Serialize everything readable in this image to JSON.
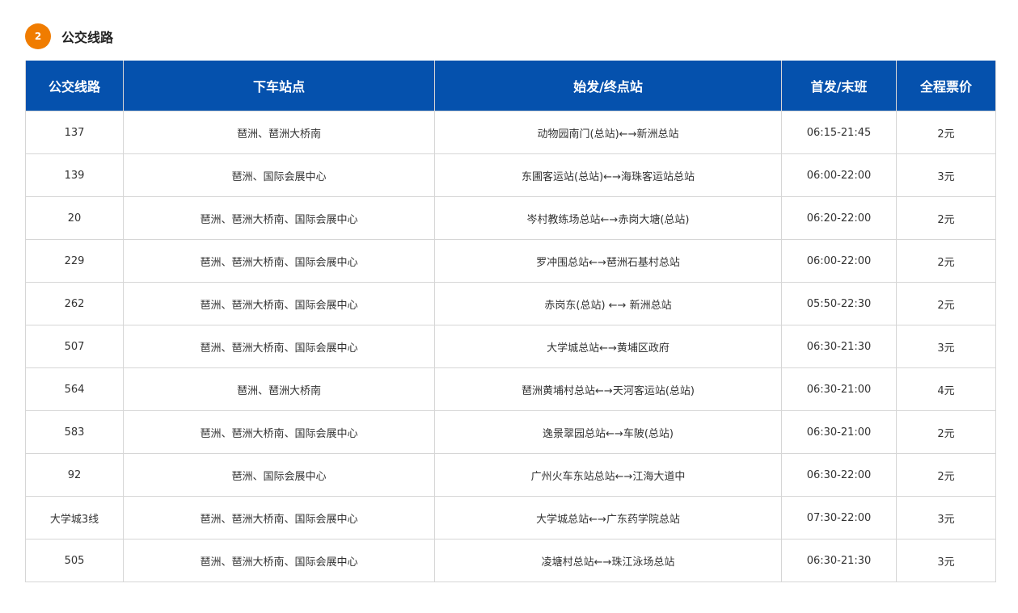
{
  "section": {
    "number": "2",
    "title": "公交线路"
  },
  "table": {
    "headers": [
      "公交线路",
      "下车站点",
      "始发/终点站",
      "首发/末班",
      "全程票价"
    ],
    "rows": [
      [
        "137",
        "琶洲、琶洲大桥南",
        "动物园南门(总站)←→新洲总站",
        "06:15-21:45",
        "2元"
      ],
      [
        "139",
        "琶洲、国际会展中心",
        "东圃客运站(总站)←→海珠客运站总站",
        "06:00-22:00",
        "3元"
      ],
      [
        "20",
        "琶洲、琶洲大桥南、国际会展中心",
        "岑村教练场总站←→赤岗大塘(总站)",
        "06:20-22:00",
        "2元"
      ],
      [
        "229",
        "琶洲、琶洲大桥南、国际会展中心",
        "罗冲围总站←→琶洲石基村总站",
        "06:00-22:00",
        "2元"
      ],
      [
        "262",
        "琶洲、琶洲大桥南、国际会展中心",
        "赤岗东(总站) ←→ 新洲总站",
        "05:50-22:30",
        "2元"
      ],
      [
        "507",
        "琶洲、琶洲大桥南、国际会展中心",
        "大学城总站←→黄埔区政府",
        "06:30-21:30",
        "3元"
      ],
      [
        "564",
        "琶洲、琶洲大桥南",
        "琶洲黄埔村总站←→天河客运站(总站)",
        "06:30-21:00",
        "4元"
      ],
      [
        "583",
        "琶洲、琶洲大桥南、国际会展中心",
        "逸景翠园总站←→车陂(总站)",
        "06:30-21:00",
        "2元"
      ],
      [
        "92",
        "琶洲、国际会展中心",
        "广州火车东站总站←→江海大道中",
        "06:30-22:00",
        "2元"
      ],
      [
        "大学城3线",
        "琶洲、琶洲大桥南、国际会展中心",
        "大学城总站←→广东药学院总站",
        "07:30-22:00",
        "3元"
      ],
      [
        "505",
        "琶洲、琶洲大桥南、国际会展中心",
        "凌塘村总站←→珠江泳场总站",
        "06:30-21:30",
        "3元"
      ]
    ]
  },
  "colors": {
    "accent": "#f07c00",
    "header_bg": "#0551ad"
  }
}
